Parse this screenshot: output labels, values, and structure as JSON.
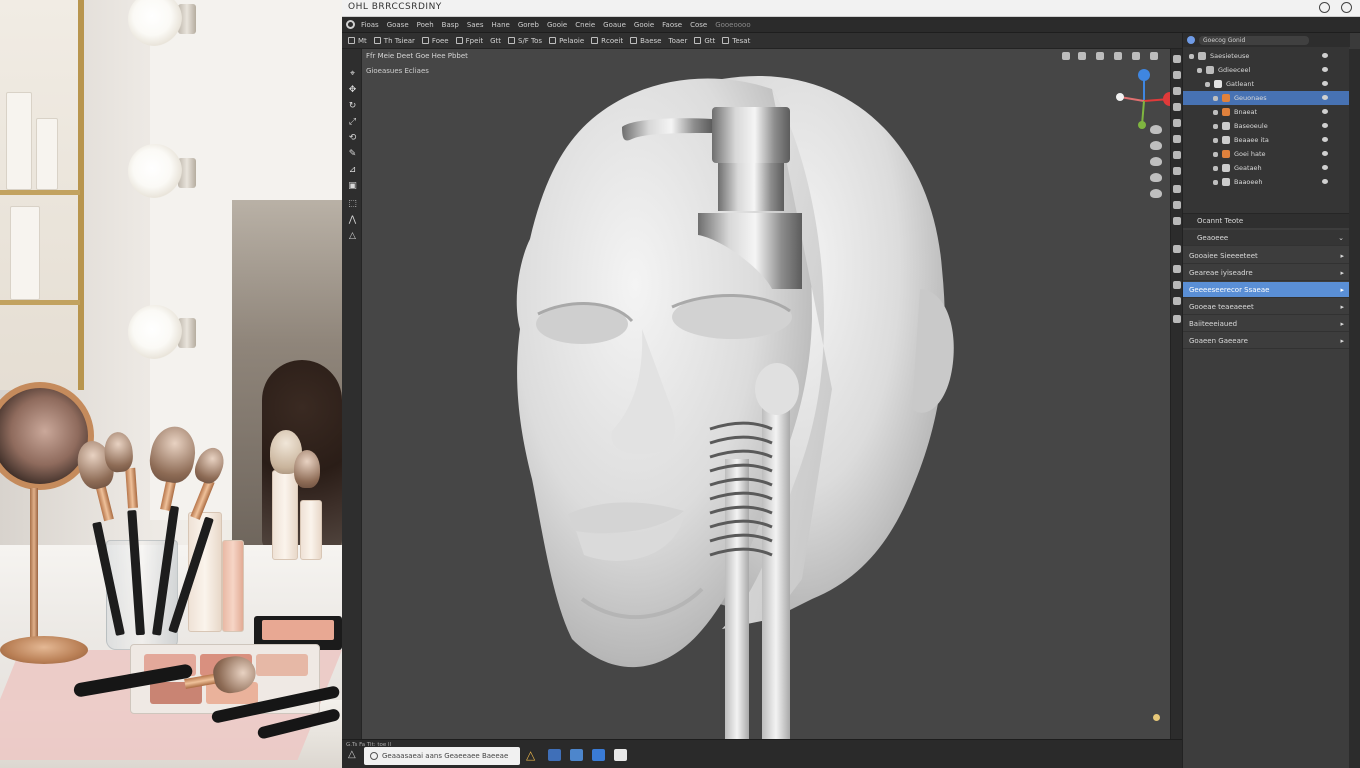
{
  "window": {
    "title": "OHL BRRCCSRDINY"
  },
  "menubar": {
    "items": [
      "Fioas",
      "Goase",
      "Poeh",
      "Basp",
      "Saes",
      "Hane",
      "Goreb",
      "Gooie",
      "Cneie",
      "Goaue",
      "Gooie",
      "Faose",
      "Cose",
      "Gooeoooo"
    ]
  },
  "toolbar": {
    "items": [
      "Mt",
      "Th Tsiear",
      "Foee",
      "Fpeit",
      "Gtt",
      "S/F Tos",
      "Pelaoie",
      "Rcoeit",
      "Baese",
      "Toaer",
      "Gtt",
      "Tesat"
    ]
  },
  "viewport": {
    "header_label": "Ffr Meie  Deet  Goe Hee  Pbbet",
    "stats": "Gioeasues  Ecliaes"
  },
  "outliner": {
    "search_text": "Goecog Gonid",
    "rows": [
      {
        "label": "Saesieteuse",
        "indent": 0,
        "icon_color": "#bdbdbd",
        "selected": false
      },
      {
        "label": "Gdieeceel",
        "indent": 1,
        "icon_color": "#bdbdbd",
        "selected": false
      },
      {
        "label": "Gatleant",
        "indent": 2,
        "icon_color": "#e2e2e2",
        "selected": false
      },
      {
        "label": "Geuonaes",
        "indent": 3,
        "icon_color": "#e0813c",
        "selected": true
      },
      {
        "label": "Bnaeat",
        "indent": 3,
        "icon_color": "#e0813c",
        "selected": false
      },
      {
        "label": "Baseoeule",
        "indent": 3,
        "icon_color": "#cccccc",
        "selected": false
      },
      {
        "label": "Beaaee ita",
        "indent": 3,
        "icon_color": "#cccccc",
        "selected": false
      },
      {
        "label": "Goei hate",
        "indent": 3,
        "icon_color": "#e0813c",
        "selected": false
      },
      {
        "label": "Geataeh",
        "indent": 3,
        "icon_color": "#cccccc",
        "selected": false
      },
      {
        "label": "Baaoeeh",
        "indent": 3,
        "icon_color": "#cccccc",
        "selected": false
      }
    ]
  },
  "properties": {
    "header": "Ocannt Teote",
    "section": "Geaoeee",
    "rows": [
      {
        "label": "Gooaiee Sieeeeteet",
        "active": false
      },
      {
        "label": "Geareae iyiseadre",
        "active": false
      },
      {
        "label": "Geeeeseerecor Ssaeae",
        "active": true
      },
      {
        "label": "Gooeae teaeaeeet",
        "active": false
      },
      {
        "label": "Baiiteeeiaued",
        "active": false
      },
      {
        "label": "Goaeen Gaeeare",
        "active": false
      }
    ]
  },
  "statusbar": {
    "mini_text": "G.Ts  Fa Tit:   toe  ll",
    "search_text": "Geaaasaeai aans Geaeeaee Baeeae"
  },
  "colors": {
    "accent": "#4772b3",
    "axis_x": "#e03a3a",
    "axis_y": "#7fb540",
    "axis_z": "#3f86e0"
  }
}
